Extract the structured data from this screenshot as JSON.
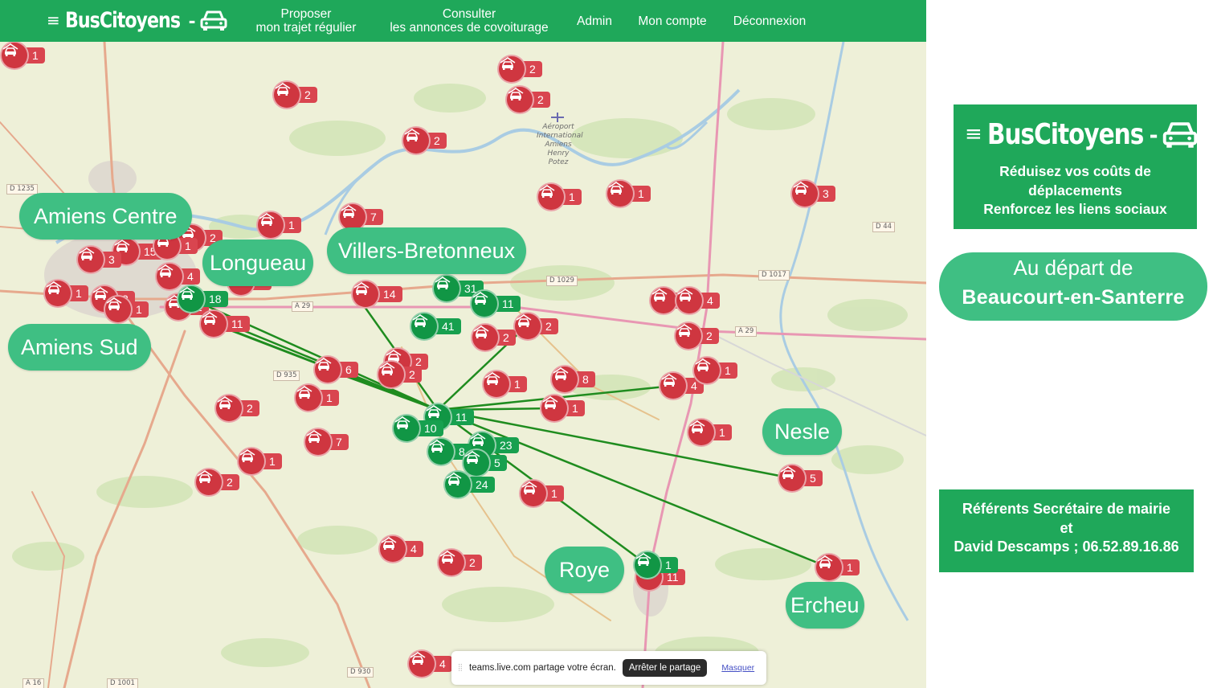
{
  "navbar": {
    "brand": "BusCitoyens",
    "links": [
      {
        "line1": "Proposer",
        "line2": "mon trajet régulier"
      },
      {
        "line1": "Consulter",
        "line2": "les annonces de covoiturage"
      },
      {
        "line1": "Admin",
        "line2": ""
      },
      {
        "line1": "Mon compte",
        "line2": ""
      },
      {
        "line1": "Déconnexion",
        "line2": ""
      }
    ]
  },
  "map": {
    "city_labels": [
      "Amiens Centre",
      "Longueau",
      "Villers-Bretonneux",
      "Amiens Sud",
      "Nesle",
      "Roye",
      "Ercheu"
    ],
    "airport": [
      "Aéroport",
      "International",
      "Amiens",
      "Henry Potez"
    ],
    "roads": [
      "D 1235",
      "D 1029",
      "D 1017",
      "D 44",
      "A 29",
      "D 935",
      "A 29",
      "D 930",
      "A 16",
      "D 1001"
    ],
    "red_counts": [
      "1",
      "2",
      "2",
      "2",
      "2",
      "1",
      "1",
      "1",
      "3",
      "7",
      "2",
      "15",
      "1",
      "3",
      "4",
      "14",
      "1",
      "3",
      "1",
      "1",
      "2",
      "11",
      "2",
      "6",
      "2",
      "2",
      "1",
      "1",
      "8",
      "4",
      "1",
      "1",
      "4",
      "2",
      "1",
      "2",
      "7",
      "1",
      "2",
      "1",
      "4",
      "2",
      "5",
      "1",
      "1",
      "11",
      "4",
      "1"
    ],
    "green_counts": [
      "18",
      "31",
      "11",
      "41",
      "11",
      "10",
      "23",
      "8",
      "5",
      "24",
      "1"
    ],
    "icon": "car-home-icon",
    "marker_colors": {
      "red": "#d9454f",
      "green": "#119645"
    }
  },
  "share_banner": {
    "text": "teams.live.com partage votre écran.",
    "stop_label": "Arrêter le partage",
    "hide_label": "Masquer"
  },
  "promo": {
    "brand": "BusCitoyens",
    "tagline_1": "Réduisez vos coûts de",
    "tagline_2": "déplacements",
    "tagline_3": "Renforcez les liens sociaux"
  },
  "departure": {
    "line1": "Au départ de",
    "line2": "Beaucourt-en-Santerre"
  },
  "contact": {
    "line1": "Référents Secrétaire de mairie",
    "line2": "et",
    "line3": "David Descamps ; 06.52.89.16.86"
  },
  "colors": {
    "brand_green": "#1fa85a",
    "label_green": "#3fbf83",
    "line_green": "#1a8a1a"
  }
}
